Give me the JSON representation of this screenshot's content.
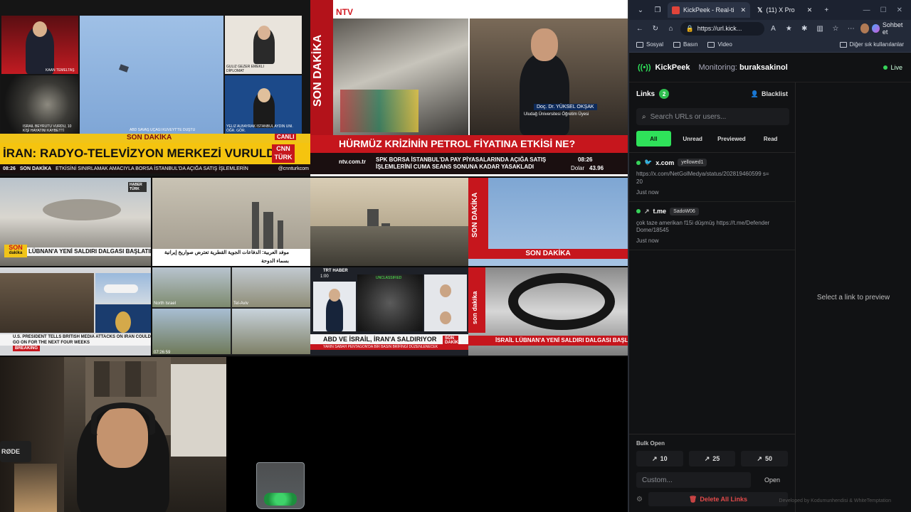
{
  "wall": {
    "tile1": {
      "anchor": "KAAN TEMELTAŞ",
      "lower_left": "İSRAİL BEYRUTU VURDU, 10 KİŞİ HAYATINI KAYBETTİ",
      "sky_caption": "ABD SAVAŞ UÇAĞI KUVEYT'TE DÜŞTÜ",
      "guest1": "GÜLİZ GEZER EMEKLİ DİPLOMAT",
      "guest2": "YELİZ ALBAYRAK İSTANBUL AYDIN ÜNİ. ÖĞR. GÖR.",
      "son_dakika": "SON DAKİKA",
      "canli": "CANLI",
      "headline": "İRAN: RADYO-TELEVİZYON MERKEZİ VURULDU",
      "logo": "CNN TÜRK",
      "time": "08:26",
      "ticker_label": "SON DAKİKA",
      "ticker": "ETKİSİNİ SINIRLAMAK AMACIYLA BORSA İSTANBUL'DA AÇIĞA SATIŞ İŞLEMLERİN",
      "handle": "@cnnturkcom"
    },
    "tile2": {
      "logo": "NTV",
      "side": "SON DAKİKA",
      "guest": "Doç. Dr. YÜKSEL OKŞAK",
      "guest_title": "Uludağ Üniversitesi Öğretim Üyesi",
      "headline": "HÜRMÜZ KRİZİNİN PETROL FİYATINA ETKİSİ NE?",
      "site": "ntv.com.tr",
      "ticker": "SPK BORSA İSTANBUL'DA PAY PİYASALARINDA AÇIĞA SATIŞ İŞLEMLERİNİ CUMA SEANS SONUNA KADAR YASAKLADI",
      "time": "08:26",
      "dolar_label": "Dolar",
      "dolar": "43.96"
    },
    "tile3": {
      "son": "SON",
      "dakika": "dakika",
      "headline": "LÜBNAN'A YENİ SALDIRI DALGASI BAŞLATILDI",
      "channel": "HABER TÜRK"
    },
    "tile4": {
      "arabic": "موفد العربية: الدفاعات الجوية القطرية تعترض صواريخ إيرانية بسماء الدوحة"
    },
    "tile5": {
      "side": "SON DAKİKA",
      "bottom": "SON DAKİKA"
    },
    "tile6": {
      "headline": "U.S. PRESIDENT TELLS BRITISH MEDIA ATTACKS ON IRAN COULD GO ON FOR THE NEXT FOUR WEEKS",
      "label": "BREAKING"
    },
    "tile7": {
      "label1": "North Israel",
      "label2": "Tel-Aviv",
      "clock": "07:26:59"
    },
    "tile8": {
      "channel": "TRT HABER",
      "time": "1:00",
      "badge": "UNCLASSIFIED",
      "headline": "ABD VE İSRAİL, İRAN'A SALDIRIYOR",
      "sub": "YARIN SABAH PENTAGON'DA BİR BASIN BRİFİNGİ DÜZENLENECEK",
      "tag": "SON DAKİKA"
    },
    "tile9": {
      "side": "son dakika",
      "headline": "İSRAİL LÜBNAN'A YENİ SALDIRI DALGASI BAŞLATTI"
    }
  },
  "cam": {
    "mic_brand": "RØDE"
  },
  "browser": {
    "tabs": [
      {
        "label": "KickPeek - Real-ti",
        "active": true,
        "color": "#e0443a"
      },
      {
        "label": "(11) X Pro",
        "active": false,
        "color": "#111111"
      }
    ],
    "url": "https://url.kick...",
    "sohbet": "Sohbet et",
    "bookmarks": [
      "Sosyal",
      "Basın",
      "Video"
    ],
    "bookmarks_right": "Diğer sık kullanılanlar"
  },
  "app": {
    "brand": "KickPeek",
    "monitoring_label": "Monitoring:",
    "monitoring_user": "buraksakinol",
    "live": "Live",
    "links_label": "Links",
    "links_count": "2",
    "blacklist": "Blacklist",
    "search_placeholder": "Search URLs or users...",
    "filters": [
      "All",
      "Unread",
      "Previewed",
      "Read"
    ],
    "items": [
      {
        "domain": "x.com",
        "user": "yellowed1",
        "body": "https://x.com/NetGolMedya/status/202819460599 s=20",
        "time": "Just now",
        "icon": "twitter-icon"
      },
      {
        "domain": "t.me",
        "user": "SadoW06",
        "body": "çok taze amerikan f15i düşmüş https://t.me/DefenderDome/18545",
        "time": "Just now",
        "icon": "telegram-icon"
      }
    ],
    "bulk_title": "Bulk Open",
    "bulk": [
      "10",
      "25",
      "50"
    ],
    "custom_placeholder": "Custom...",
    "open": "Open",
    "delete_all": "Delete All Links",
    "preview_hint": "Select a link to preview",
    "footer": "Developed by Kodumunhendisi & WhiteTemptation"
  }
}
